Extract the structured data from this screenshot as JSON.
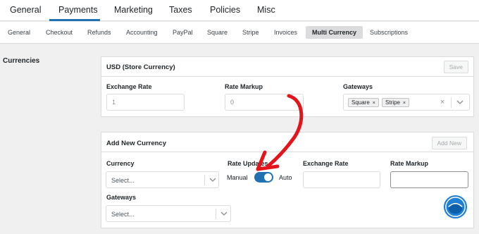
{
  "top_tabs": [
    "General",
    "Payments",
    "Marketing",
    "Taxes",
    "Policies",
    "Misc"
  ],
  "sub_tabs": [
    "General",
    "Checkout",
    "Refunds",
    "Accounting",
    "PayPal",
    "Square",
    "Stripe",
    "Invoices",
    "Multi Currency",
    "Subscriptions"
  ],
  "active_top_tab": "Payments",
  "active_sub_tab": "Multi Currency",
  "section": {
    "label": "Currencies"
  },
  "usd_panel": {
    "title": "USD (Store Currency)",
    "save_label": "Save",
    "exchange_rate_label": "Exchange Rate",
    "exchange_rate_value": "1",
    "rate_markup_label": "Rate Markup",
    "rate_markup_value": "0",
    "gateways_label": "Gateways",
    "gateways": [
      "Square",
      "Stripe"
    ],
    "chip_remove": "×",
    "clear": "×"
  },
  "new_panel": {
    "title": "Add New Currency",
    "add_label": "Add New",
    "currency_label": "Currency",
    "currency_placeholder": "Select...",
    "rate_updates_label": "Rate Updates",
    "manual_label": "Manual",
    "auto_label": "Auto",
    "rate_updates_auto": true,
    "exchange_rate_label": "Exchange Rate",
    "rate_markup_label": "Rate Markup",
    "gateways_label": "Gateways",
    "gateways_placeholder": "Select..."
  },
  "colors": {
    "accent": "#2271b1",
    "annotation": "#e3141b",
    "badge": "#1e7fd6"
  },
  "icons": {
    "chevron": "chevron-down-icon",
    "arrow": "annotation-arrow",
    "badge": "logo-badge-icon"
  }
}
